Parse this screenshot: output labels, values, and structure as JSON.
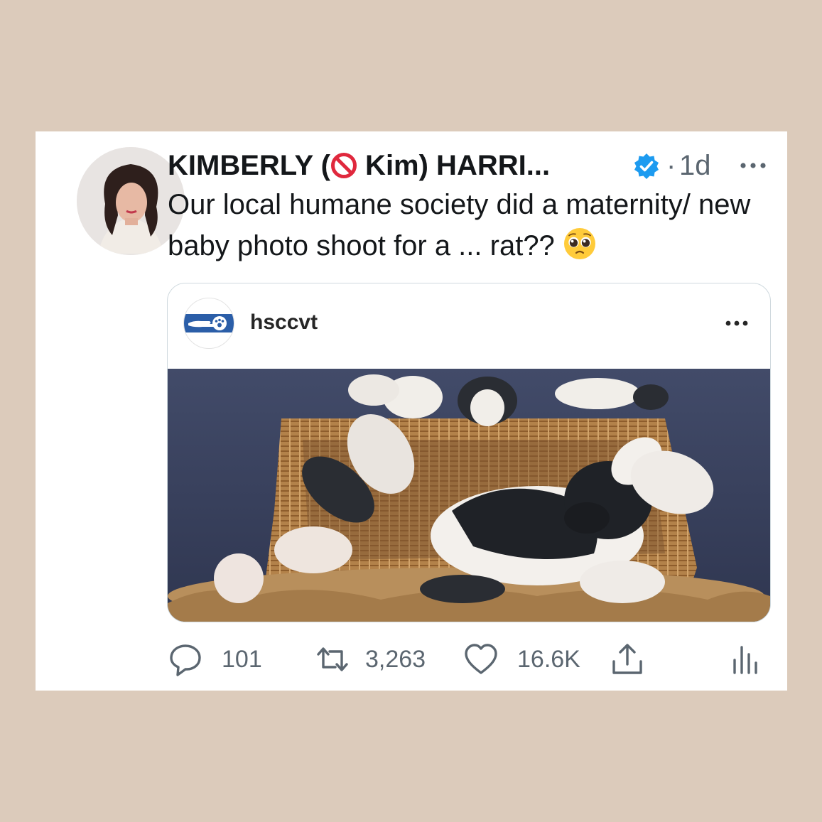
{
  "tweet": {
    "author_name_prefix": "KIMBERLY (",
    "author_name_suffix": " Kim) HARRI...",
    "time_separator": "·",
    "time": "1d",
    "text": "Our local humane society did a maternity/ new baby photo shoot for a ... rat??",
    "emoji": "pleading-face"
  },
  "embed": {
    "account": "hsccvt"
  },
  "actions": {
    "replies": "101",
    "retweets": "3,263",
    "likes": "16.6K"
  },
  "icons": [
    "no-entry-icon",
    "verified-badge-icon",
    "more-icon",
    "reply-icon",
    "retweet-icon",
    "like-icon",
    "share-icon",
    "analytics-icon"
  ],
  "colors": {
    "background": "#dccbbb",
    "verified": "#1d9bf0",
    "text": "#14171a",
    "muted": "#5b6670",
    "logo_blue": "#2b5ea8"
  }
}
